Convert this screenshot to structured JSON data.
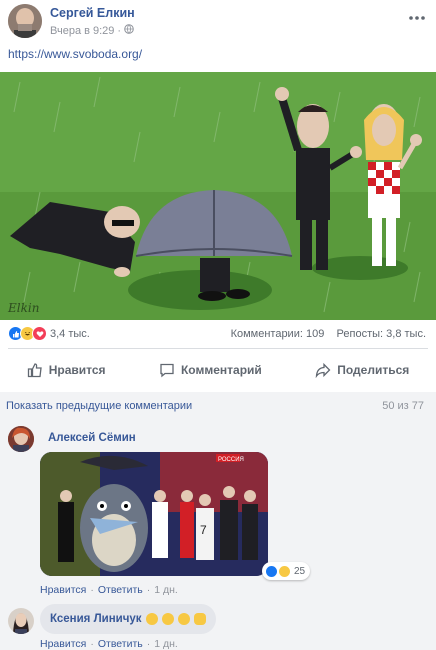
{
  "post": {
    "author": "Сергей Елкин",
    "time": "Вчера в 9:29",
    "separator": "·",
    "link": "https://www.svoboda.org/",
    "watermark": "Elkin"
  },
  "reactions": {
    "count": "3,4 тыс.",
    "comments": "Комментарии: 109",
    "shares": "Репосты: 3,8 тыс."
  },
  "actions": {
    "like": "Нравится",
    "comment": "Комментарий",
    "share": "Поделиться"
  },
  "comments_section": {
    "previous": "Показать предыдущие комментарии",
    "count": "50 из 77",
    "comments": [
      {
        "author": "Алексей Сёмин",
        "like_label": "Нравится",
        "reply_label": "Ответить",
        "age": "1 дн.",
        "reaction_count": "25",
        "image_caption": "РОССИЯ"
      },
      {
        "author": "Ксения Линичук",
        "like_label": "Нравится",
        "reply_label": "Ответить",
        "age": "1 дн."
      }
    ]
  },
  "colors": {
    "link": "#385898",
    "like": "#1877f2",
    "love": "#f33e58",
    "haha": "#f7c843",
    "grass": "#5a9a3c"
  }
}
